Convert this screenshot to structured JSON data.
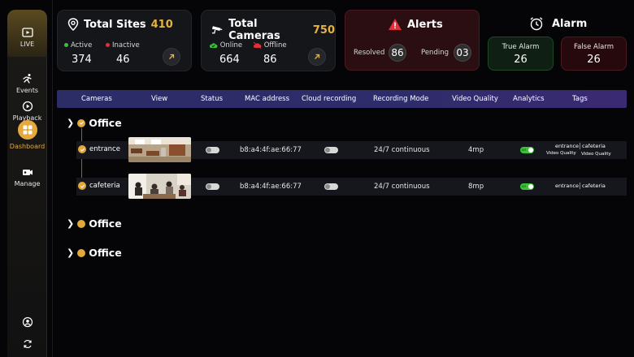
{
  "sidebar": {
    "items": [
      {
        "label": "LIVE",
        "icon": "live-icon"
      },
      {
        "label": "Events",
        "icon": "events-icon"
      },
      {
        "label": "Playback",
        "icon": "playback-icon"
      },
      {
        "label": "Dashboard",
        "icon": "dashboard-icon",
        "active": true
      },
      {
        "label": "Manage",
        "icon": "manage-icon"
      }
    ],
    "bottom_icons": [
      "user-icon",
      "sync-icon"
    ]
  },
  "sites": {
    "title": "Total Sites",
    "total": "410",
    "active_label": "Active",
    "active": "374",
    "inactive_label": "Inactive",
    "inactive": "46"
  },
  "cameras": {
    "title": "Total Cameras",
    "total": "750",
    "online_label": "Online",
    "online": "664",
    "offline_label": "Offline",
    "offline": "86"
  },
  "alerts": {
    "title": "Alerts",
    "resolved_label": "Resolved",
    "resolved": "86",
    "pending_label": "Pending",
    "pending": "03"
  },
  "alarm": {
    "title": "Alarm",
    "true_label": "True Alarm",
    "true_value": "26",
    "false_label": "False Alarm",
    "false_value": "26"
  },
  "table": {
    "headers": [
      "Cameras",
      "View",
      "Status",
      "MAC address",
      "Cloud recording",
      "Recording Mode",
      "Video Quality",
      "Analytics",
      "Tags"
    ],
    "groups": [
      {
        "name": "Office",
        "expanded": true
      },
      {
        "name": "Office",
        "expanded": false
      },
      {
        "name": "Office",
        "expanded": false
      }
    ],
    "rows": [
      {
        "name": "entrance",
        "status": "off",
        "mac": "b8:a4:4f:ae:66:77",
        "cloud": "off",
        "mode": "24/7 continuous",
        "quality": "4mp",
        "analytics": "on",
        "analytics_label": "on",
        "tag1": "entrance",
        "tag2": "cafeteria",
        "sub1": "Video Quality",
        "sub2": "Video Quality"
      },
      {
        "name": "cafeteria",
        "status": "off",
        "mac": "b8:a4:4f:ae:66:77",
        "cloud": "off",
        "mode": "24/7 continuous",
        "quality": "8mp",
        "analytics": "on",
        "analytics_label": "on",
        "tag1": "entrance",
        "tag2": "cafeteria"
      }
    ]
  },
  "colors": {
    "accent": "#e6b33c",
    "online": "#38c437",
    "offline": "#e0303a",
    "header_bar": "#2e2c6a"
  }
}
